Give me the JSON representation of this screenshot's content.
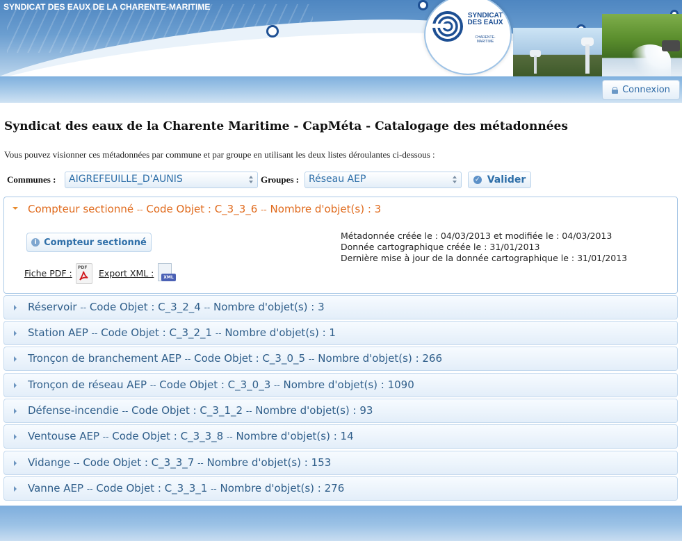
{
  "banner": {
    "title": "SYNDICAT DES EAUX DE LA CHARENTE-MARITIME",
    "logo_line1": "SYNDICAT",
    "logo_line2": "DES EAUX",
    "logo_sub": "CHARENTE-MARITIME"
  },
  "nav": {
    "login_label": "Connexion",
    "login_icon": "lock-icon"
  },
  "page": {
    "title": "Syndicat des eaux de la Charente Maritime - CapMéta - Catalogage des métadonnées",
    "intro": "Vous pouvez visionner ces métadonnées par commune et par groupe en utilisant les deux listes déroulantes ci-dessous :"
  },
  "filters": {
    "communes_label": "Communes :",
    "communes_value": "AIGREFEUILLE_D'AUNIS",
    "groupes_label": "Groupes :",
    "groupes_value": "Réseau AEP",
    "validate_label": "Valider",
    "validate_icon": "check-circle-icon"
  },
  "accordion": {
    "open": {
      "name": "Compteur sectionné",
      "code": "Code Objet : C_3_3_6",
      "count": "Nombre d'objet(s) : 3",
      "sub_button": "Compteur sectionné",
      "meta_line1": "Métadonnée créée le : 04/03/2013 et modifiée le : 04/03/2013",
      "meta_line2": "Donnée cartographique créée le : 31/01/2013",
      "meta_line3": "Dernière mise à jour de la donnée cartographique le : 31/01/2013",
      "pdf_link": "Fiche PDF :",
      "pdf_icon_tag": "PDF",
      "xml_link": "Export XML :",
      "xml_icon_tag": "XML"
    },
    "separator": "--",
    "items": [
      {
        "name": "Réservoir",
        "code": "Code Objet : C_3_2_4",
        "count": "Nombre d'objet(s) : 3"
      },
      {
        "name": "Station AEP",
        "code": "Code Objet : C_3_2_1",
        "count": "Nombre d'objet(s) : 1"
      },
      {
        "name": "Tronçon de branchement AEP",
        "code": "Code Objet : C_3_0_5",
        "count": "Nombre d'objet(s) : 266"
      },
      {
        "name": "Tronçon de réseau AEP",
        "code": "Code Objet : C_3_0_3",
        "count": "Nombre d'objet(s) : 1090"
      },
      {
        "name": "Défense-incendie",
        "code": "Code Objet : C_3_1_2",
        "count": "Nombre d'objet(s) : 93"
      },
      {
        "name": "Ventouse AEP",
        "code": "Code Objet : C_3_3_8",
        "count": "Nombre d'objet(s) : 14"
      },
      {
        "name": "Vidange",
        "code": "Code Objet : C_3_3_7",
        "count": "Nombre d'objet(s) : 153"
      },
      {
        "name": "Vanne AEP",
        "code": "Code Objet : C_3_3_1",
        "count": "Nombre d'objet(s) : 276"
      }
    ]
  },
  "colors": {
    "accent_blue": "#2d6ea8",
    "open_item_orange": "#e06a1c",
    "item_text": "#2f5e8a",
    "banner_blue": "#4e86c1"
  }
}
